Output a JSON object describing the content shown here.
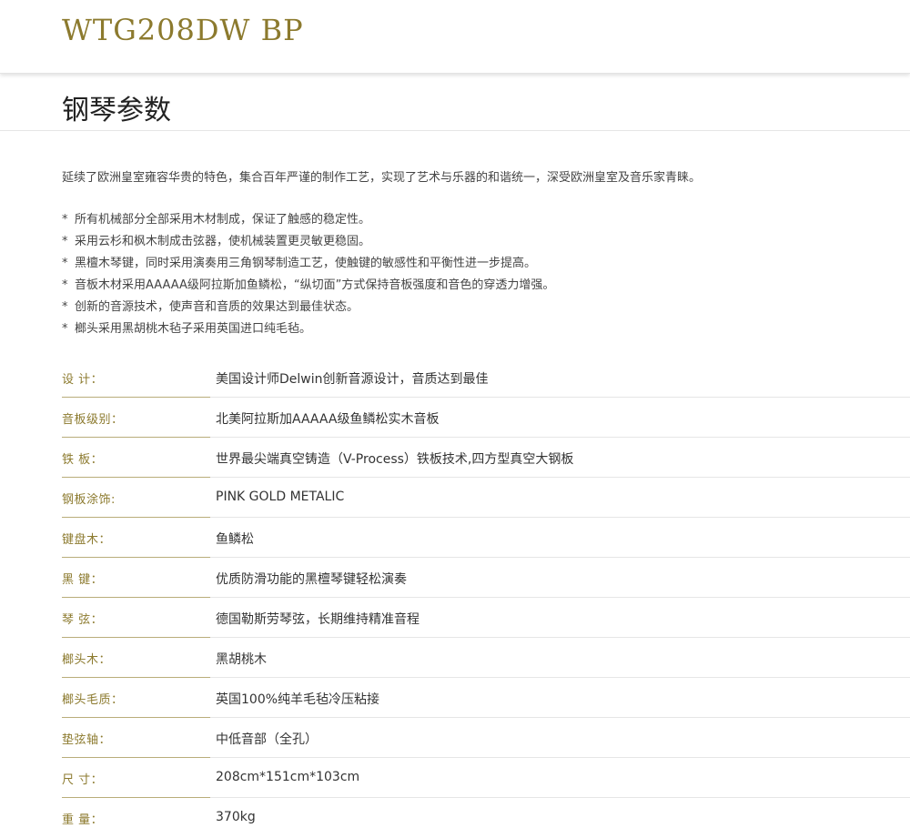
{
  "header": {
    "model": "WTG208DW BP"
  },
  "section": {
    "title": "钢琴参数"
  },
  "intro": "延续了欧洲皇室雍容华贵的特色，集合百年严谨的制作工艺，实现了艺术与乐器的和谐统一，深受欧洲皇室及音乐家青睐。",
  "features": [
    {
      "marker": "*",
      "text": "所有机械部分全部采用木材制成，保证了触感的稳定性。"
    },
    {
      "marker": "*",
      "text": "采用云杉和枫木制成击弦器，使机械装置更灵敏更稳固。"
    },
    {
      "marker": "*",
      "text": "黑檀木琴键，同时采用演奏用三角钢琴制造工艺，使触键的敏感性和平衡性进一步提高。"
    },
    {
      "marker": "*",
      "text": "音板木材采用AAAAA级阿拉斯加鱼鳞松，“纵切面”方式保持音板强度和音色的穿透力增强。"
    },
    {
      "marker": "*",
      "text": "创新的音源技术，使声音和音质的效果达到最佳状态。"
    },
    {
      "marker": "*",
      "text": "榔头采用黑胡桃木毡子采用英国进口纯毛毡。"
    }
  ],
  "specs": [
    {
      "label": "设 计：",
      "value": "美国设计师Delwin创新音源设计，音质达到最佳"
    },
    {
      "label": "音板级别：",
      "value": "北美阿拉斯加AAAAA级鱼鳞松实木音板"
    },
    {
      "label": "铁 板：",
      "value": "世界最尖端真空铸造（V-Process）铁板技术,四方型真空大钢板"
    },
    {
      "label": "钢板涂饰:",
      "value": "PINK GOLD METALIC"
    },
    {
      "label": "键盘木：",
      "value": "鱼鳞松"
    },
    {
      "label": "黑 键：",
      "value": "优质防滑功能的黑檀琴键轻松演奏"
    },
    {
      "label": "琴 弦：",
      "value": "德国勒斯劳琴弦，长期维持精准音程"
    },
    {
      "label": "榔头木：",
      "value": "黑胡桃木"
    },
    {
      "label": "榔头毛质：",
      "value": "英国100%纯羊毛毡冷压粘接"
    },
    {
      "label": "垫弦轴：",
      "value": "中低音部（全孔）"
    },
    {
      "label": "尺 寸：",
      "value": "208cm*151cm*103cm"
    },
    {
      "label": "重 量：",
      "value": "370kg"
    }
  ],
  "colors": {
    "accent_gold": "#8c7a2e",
    "text": "#333333",
    "rule": "#e6e6e6"
  }
}
